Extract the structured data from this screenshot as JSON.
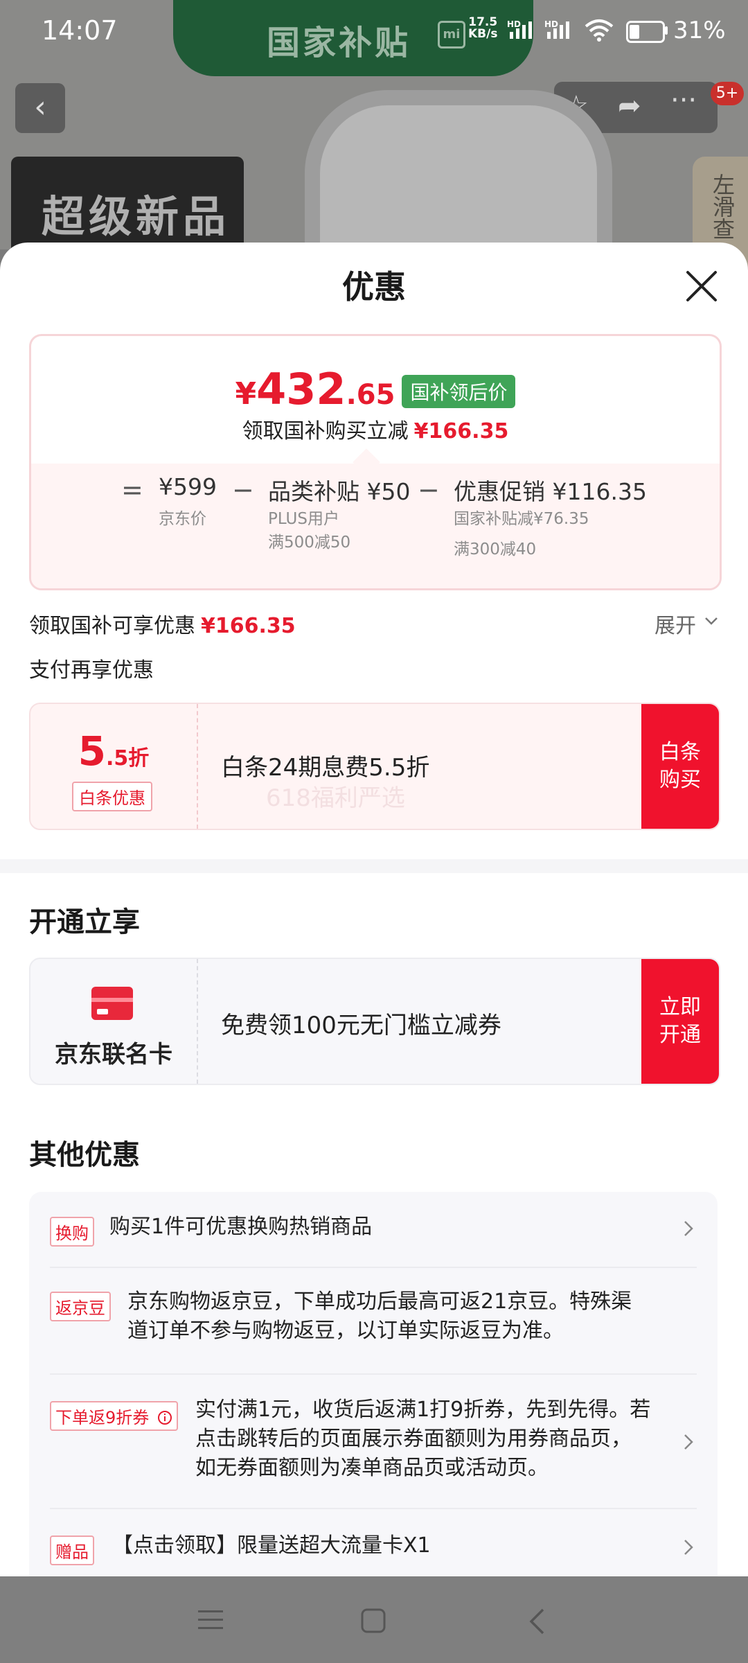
{
  "status_bar": {
    "time": "14:07",
    "net_speed_top": "17.5",
    "net_speed_bottom": "KB/s",
    "hd1": "HD",
    "hd2": "HD",
    "battery_percent": "31%"
  },
  "background": {
    "banner_text": "国家补贴",
    "mi_logo": "mi",
    "back_icon": "‹",
    "badge": "5+",
    "super_new": "超级新品",
    "side_text": "左滑查"
  },
  "sheet": {
    "title": "优惠",
    "price_card": {
      "yen": "¥",
      "price_int": "432",
      "price_dec": ".65",
      "tag": "国补领后价",
      "sub_label": "领取国补购买立减",
      "sub_amount": "¥166.35",
      "breakdown": {
        "eq": "=",
        "minus1": "−",
        "minus2": "−",
        "base_price": "¥599",
        "base_label": "京东价",
        "category_main": "品类补贴 ¥50",
        "category_sub1": "PLUS用户",
        "category_sub2": "满500减50",
        "promo_main": "优惠促销 ¥116.35",
        "promo_sub1": "国家补贴减¥76.35",
        "promo_sub2": "满300减40"
      }
    },
    "enjoy_label": "领取国补可享优惠",
    "enjoy_amount": "¥166.35",
    "expand_label": "展开",
    "pay_more_label": "支付再享优惠",
    "baitiao": {
      "num": "5",
      "unit": ".5折",
      "tag": "白条优惠",
      "desc": "白条24期息费5.5折",
      "watermark": "618福利严选",
      "button": "白条购买"
    },
    "open_section_title": "开通立享",
    "card_offer": {
      "name": "京东联名卡",
      "desc": "免费领100元无门槛立减券",
      "button": "立即开通"
    },
    "other_title": "其他优惠",
    "other_items": [
      {
        "tag": "换购",
        "text": "购买1件可优惠换购热销商品"
      },
      {
        "tag": "返京豆",
        "text": "京东购物返京豆，下单成功后最高可返21京豆。特殊渠道订单不参与购物返豆，以订单实际返豆为准。",
        "line1": "京东购物返京豆，下单成功后最高可返21京豆。特殊渠",
        "line2": "道订单不参与购物返豆，以订单实际返豆为准。"
      },
      {
        "tag": "下单返9折券",
        "text": "实付满1元，收货后返满1打9折券，先到先得。若点击跳转后的页面展示券面额则为用券商品页，如无券面额则为凑单商品页或活动页。",
        "line1": "实付满1元，收货后返满1打9折券，先到先得。若",
        "line2": "点击跳转后的页面展示券面额则为用券商品页，",
        "line3": "如无券面额则为凑单商品页或活动页。"
      },
      {
        "tag": "赠品",
        "text": "【点击领取】限量送超大流量卡X1"
      }
    ]
  },
  "colors": {
    "accent_red": "#e61b2e",
    "button_red": "#f0122d",
    "tag_green": "#3fa457"
  },
  "icons": [
    "back-icon",
    "star-icon",
    "share-icon",
    "more-icon",
    "close-icon",
    "chevron-down-icon",
    "chevron-right-icon",
    "info-icon",
    "card-icon",
    "menu-icon",
    "home-icon",
    "nav-back-icon"
  ]
}
